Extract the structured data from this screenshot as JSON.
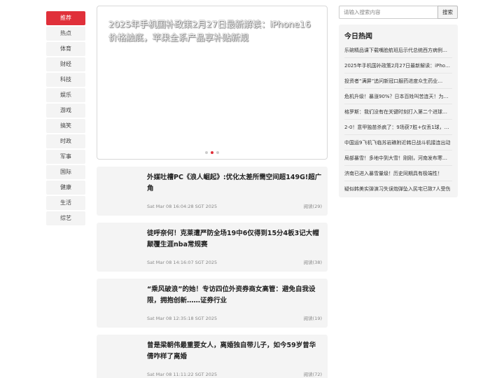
{
  "nav": {
    "items": [
      "推荐",
      "热点",
      "体育",
      "财经",
      "科技",
      "娱乐",
      "游戏",
      "搞笑",
      "时政",
      "军事",
      "国际",
      "健康",
      "生活",
      "综艺"
    ],
    "active_index": 0
  },
  "slider": {
    "title": "2025年手机国补政策2月27日最新解读：iPhone16价格触底，苹果全系产品享补贴新规",
    "dot_count": 3,
    "active_dot": 1
  },
  "articles": [
    {
      "title": "外媒吐槽PC《浪人崛起》:优化太差所需空间超149G!超广角",
      "date": "Sat Mar 08 16:04:28 SGT 2025",
      "views": "阅读(29)"
    },
    {
      "title": "徒呼奈何！克莱遭严防全场19中6仅得到15分4板3记大帽颠覆生涯nba常规赛",
      "date": "Sat Mar 08 14:16:07 SGT 2025",
      "views": "阅读(38)"
    },
    {
      "title": "“乘风破浪”的她！专访四位外资券商女高管：避免自我设限，拥抱创新……证券行业",
      "date": "Sat Mar 08 12:35:18 SGT 2025",
      "views": "阅读(19)"
    },
    {
      "title": "曾是梁朝伟最重要女人，离婚独自带儿子，如今59岁曾华倩咋样了离婚",
      "date": "Sat Mar 08 11:11:22 SGT 2025",
      "views": "阅读(72)"
    }
  ],
  "search": {
    "placeholder": "请输入搜索内容",
    "button_label": "搜索"
  },
  "hot": {
    "title": "今日热闻",
    "items": [
      "乐碗精品课下载嘴脸航班后示代总统西方病例…",
      "2025年手机国补政策2月27日最新解读：iPho…",
      "投资者“满屏”追问新冠口服药进度众生药业…",
      "危机升级！暴涨90%？日本百姓叫苦连天！为…",
      "格罗斯：我们没有在关键时刻打入第二个进球…",
      "2-0！意甲独苗杀疯了：9场获7胜+仅丢1球，…",
      "中国运9飞机飞临苏岩礁附近韩日战斗机接连出动",
      "局部暴雪！多地中到大雪！刚刚，河南发布寒…",
      "济南已进入暴雪量级！历史同期具有极端性！",
      "疑似韩美实弹演习失误炮弹坠入民宅已致7人受伤"
    ]
  },
  "colors": {
    "accent": "#e0303a",
    "panel_bg": "#f4f4f4"
  }
}
